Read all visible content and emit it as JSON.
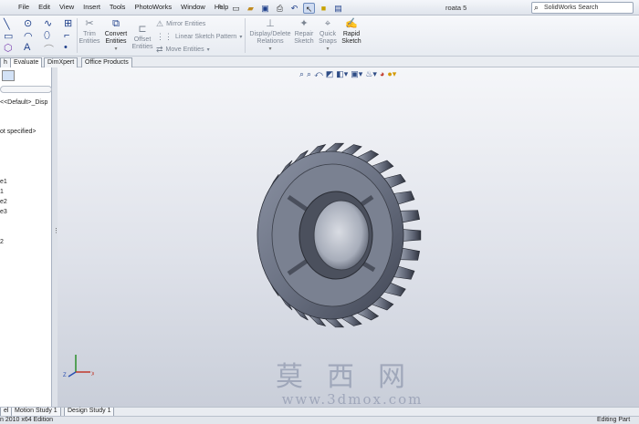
{
  "menu": [
    "File",
    "Edit",
    "View",
    "Insert",
    "Tools",
    "PhotoWorks",
    "Window",
    "Help"
  ],
  "document_title": "roata 5",
  "search": {
    "placeholder": "SolidWorks Search"
  },
  "ribbon": {
    "trim": [
      "Trim",
      "Entities"
    ],
    "convert": [
      "Convert",
      "Entities"
    ],
    "offset": [
      "Offset",
      "Entities"
    ],
    "mirror": "Mirror Entities",
    "linear_pattern": "Linear Sketch Pattern",
    "move": "Move Entities",
    "display_delete": [
      "Display/Delete",
      "Relations"
    ],
    "repair": [
      "Repair",
      "Sketch"
    ],
    "quick_snaps": [
      "Quick",
      "Snaps"
    ],
    "rapid_sketch": [
      "Rapid",
      "Sketch"
    ]
  },
  "tabs": [
    "h",
    "Evaluate",
    "DimXpert",
    "Office Products"
  ],
  "feature_tree": {
    "lines": [
      "<<Default>_Disp",
      "ot specified>",
      "e1",
      "1",
      "e2",
      "e3",
      "2"
    ]
  },
  "bottom_tabs": [
    "el",
    "Motion Study 1",
    "Design Study 1"
  ],
  "status": {
    "left": "n 2010 x64 Edition",
    "right": "Editing Part"
  },
  "watermark": {
    "chinese": "莫西网",
    "url": "www.3dmox.com"
  },
  "colors": {
    "accent": "#1e3f8a",
    "viewport_top": "#f5f6f9",
    "viewport_bottom": "#c9ced9",
    "gear": "#6f7687"
  },
  "icons": {
    "ribbon": [
      "line-icon",
      "circle-icon",
      "spline-icon",
      "rectangle-icon",
      "arc-icon",
      "ellipse-icon",
      "polygon-icon",
      "point-icon",
      "trim-icon",
      "convert-icon",
      "offset-icon",
      "mirror-icon",
      "pattern-icon",
      "move-icon",
      "relations-icon",
      "repair-icon",
      "snaps-icon",
      "rapid-sketch-icon"
    ],
    "headsup": [
      "zoom-fit-icon",
      "zoom-area-icon",
      "previous-view-icon",
      "section-view-icon",
      "view-orientation-icon",
      "display-style-icon",
      "hide-show-icon",
      "appearance-icon",
      "scene-icon"
    ]
  }
}
